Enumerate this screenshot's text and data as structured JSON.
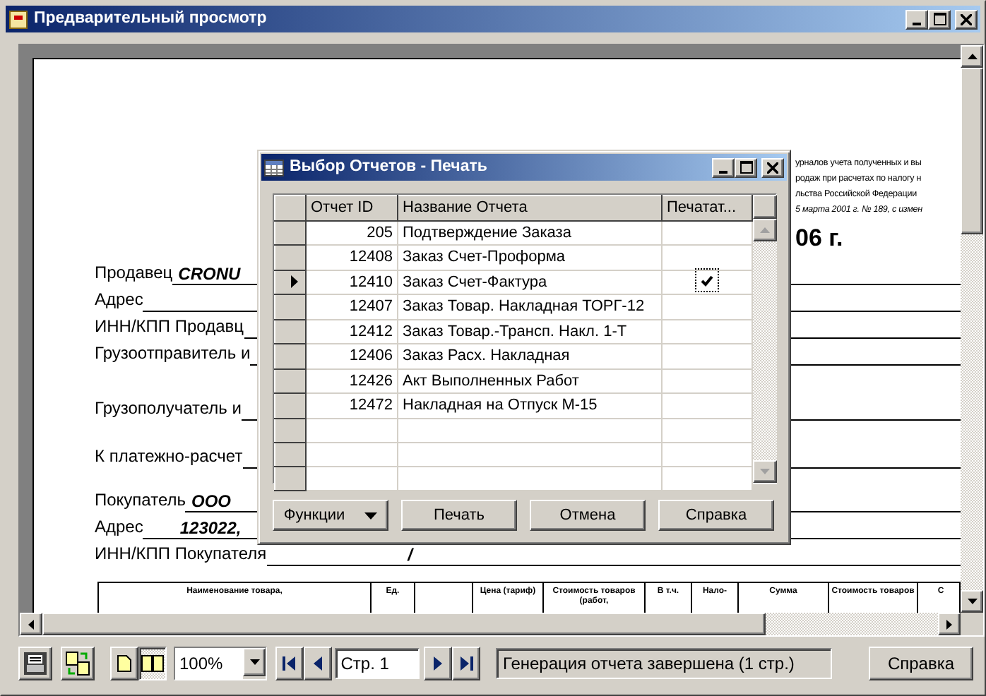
{
  "window": {
    "title": "Предварительный просмотр"
  },
  "document": {
    "header_notes": [
      "урналов учета полученных и вы",
      "родаж при расчетах по налогу н",
      "льства Российской Федерации",
      "5 марта 2001 г. № 189, с измен"
    ],
    "date_fragment": "06 г.",
    "fields": [
      {
        "label": "Продавец",
        "value": "CRONU"
      },
      {
        "label": "Адрес"
      },
      {
        "label": "ИНН/КПП Продавц"
      },
      {
        "label": "Грузоотправитель и"
      },
      {
        "label": "Грузополучатель и"
      },
      {
        "label": "К платежно-расчет"
      },
      {
        "label": "Покупатель",
        "value": "ООО"
      },
      {
        "label": "Адрес",
        "value": "123022,"
      },
      {
        "label": "ИНН/КПП Покупателя",
        "value": "/"
      }
    ],
    "table_columns": [
      {
        "label": "Наименование товара,"
      },
      {
        "label": "Ед."
      },
      {},
      {
        "label": "Цена (тариф)"
      },
      {
        "label": "Стоимость товаров (работ,"
      },
      {
        "label": "В т.ч."
      },
      {
        "label": "Нало-"
      },
      {
        "label": "Сумма"
      },
      {
        "label": "Стоимость товаров"
      },
      {
        "label": "С"
      }
    ]
  },
  "dialog": {
    "title": "Выбор Отчетов - Печать",
    "columns": [
      "Отчет ID",
      "Название Отчета",
      "Печатат..."
    ],
    "rows": [
      {
        "id": "205",
        "name": "Подтверждение Заказа",
        "printed": false,
        "selected": false
      },
      {
        "id": "12408",
        "name": "Заказ Счет-Проформа",
        "printed": false,
        "selected": false
      },
      {
        "id": "12410",
        "name": "Заказ Счет-Фактура",
        "printed": true,
        "selected": true
      },
      {
        "id": "12407",
        "name": "Заказ Товар. Накладная ТОРГ-12",
        "printed": false,
        "selected": false
      },
      {
        "id": "12412",
        "name": "Заказ Товар.-Трансп. Накл. 1-Т",
        "printed": false,
        "selected": false
      },
      {
        "id": "12406",
        "name": "Заказ Расх. Накладная",
        "printed": false,
        "selected": false
      },
      {
        "id": "12426",
        "name": "Акт Выполненных Работ",
        "printed": false,
        "selected": false
      },
      {
        "id": "12472",
        "name": "Накладная на Отпуск М-15",
        "printed": false,
        "selected": false
      }
    ],
    "buttons": [
      {
        "label": "Функции",
        "kind": "menu"
      },
      {
        "label": "Печать",
        "kind": "push"
      },
      {
        "label": "Отмена",
        "kind": "push"
      },
      {
        "label": "Справка",
        "kind": "push"
      }
    ]
  },
  "toolbar": {
    "view_modes": [
      {
        "kind": "single",
        "selected": false
      },
      {
        "kind": "double",
        "selected": true
      }
    ],
    "zoom": "100%",
    "page_field": "Стр. 1",
    "status": "Генерация отчета завершена (1 стр.)",
    "help_button": "Справка"
  }
}
